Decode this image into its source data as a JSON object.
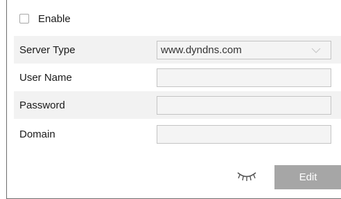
{
  "enable": {
    "label": "Enable",
    "checked": false
  },
  "fields": {
    "server_type": {
      "label": "Server Type",
      "value": "www.dyndns.com"
    },
    "user_name": {
      "label": "User Name",
      "value": ""
    },
    "password": {
      "label": "Password",
      "value": ""
    },
    "domain": {
      "label": "Domain",
      "value": ""
    }
  },
  "actions": {
    "edit_label": "Edit"
  },
  "icons": {
    "visibility": "closed-eye-icon",
    "dropdown": "chevron-down-icon"
  },
  "colors": {
    "button_bg": "#a6a6a6",
    "row_shade": "#f2f2f2",
    "field_bg": "#f4f4f4"
  }
}
